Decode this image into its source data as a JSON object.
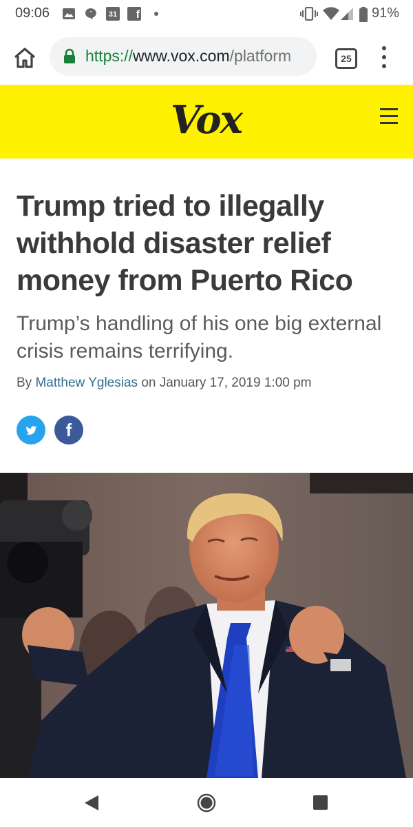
{
  "status_bar": {
    "time": "09:06",
    "calendar_day": "31",
    "battery": "91%"
  },
  "browser": {
    "url_scheme": "https://",
    "url_host": "www.vox.com",
    "url_path": "/platform",
    "tab_count": "25"
  },
  "site": {
    "logo": "Vox",
    "brand_color": "#fff200"
  },
  "article": {
    "headline": "Trump tried to illegally withhold disaster relief money from Puerto Rico",
    "dek": "Trump’s handling of his one big external crisis remains terrifying.",
    "byline_prefix": "By",
    "author": "Matthew Yglesias",
    "byline_on": "on",
    "date": "January 17, 2019 1:00 pm",
    "share_facebook": "f"
  }
}
